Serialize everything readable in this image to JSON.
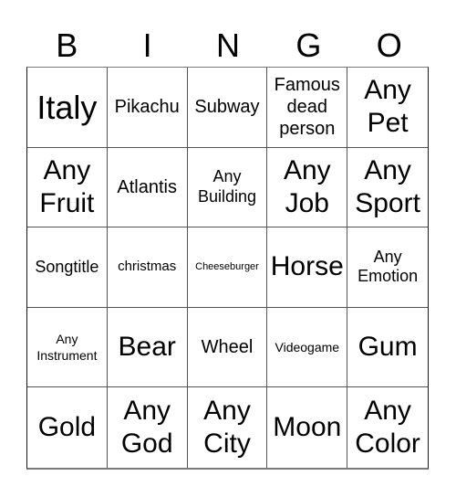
{
  "header": {
    "letters": [
      "B",
      "I",
      "N",
      "G",
      "O"
    ]
  },
  "card": {
    "rows": [
      [
        "Italy",
        "Pikachu",
        "Subway",
        "Famous dead person",
        "Any Pet"
      ],
      [
        "Any Fruit",
        "Atlantis",
        "Any Building",
        "Any Job",
        "Any Sport"
      ],
      [
        "Songtitle",
        "christmas",
        "Cheeseburger",
        "Horse",
        "Any Emotion"
      ],
      [
        "Any Instrument",
        "Bear",
        "Wheel",
        "Videogame",
        "Gum"
      ],
      [
        "Gold",
        "Any God",
        "Any City",
        "Moon",
        "Any Color"
      ]
    ]
  }
}
